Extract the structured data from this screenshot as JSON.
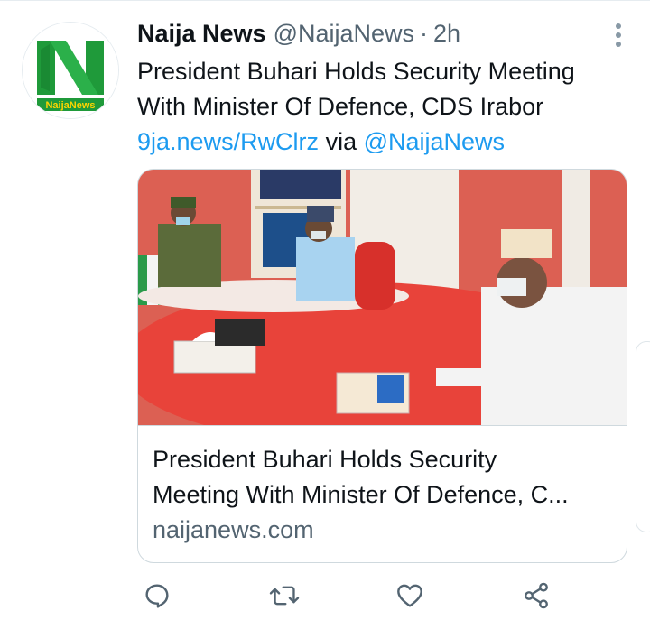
{
  "tweet": {
    "author_name": "Naija News",
    "author_handle": "@NaijaNews",
    "separator": "·",
    "time": "2h",
    "text_line1": "President Buhari Holds Security Meeting",
    "text_line2": "With Minister Of Defence, CDS Irabor",
    "short_link": "9ja.news/RwClrz",
    "via_text": "via",
    "mention": "@NaijaNews",
    "avatar_logo_text": "NaijaNews"
  },
  "card": {
    "title_line1": "President Buhari Holds Security",
    "title_line2": "Meeting With Minister Of Defence, C...",
    "domain": "naijanews.com"
  },
  "actions": [
    "reply-icon",
    "retweet-icon",
    "like-icon",
    "share-icon"
  ],
  "colors": {
    "link": "#1d9bf0",
    "secondary": "#536471",
    "icon": "#536471",
    "brand_green": "#1f9a3a"
  }
}
